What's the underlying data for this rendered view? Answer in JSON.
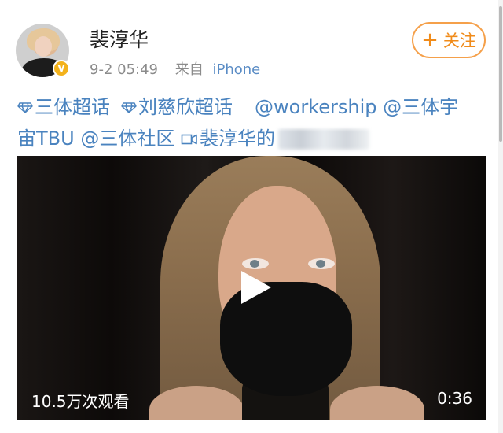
{
  "post": {
    "author": "裴淳华",
    "time": "9-2 05:49",
    "source_prefix": "来自",
    "source_client": "iPhone",
    "follow_label": "关注",
    "follow_icon": "plus-icon",
    "verified_badge": "V",
    "content": {
      "topic_1": "三体超话",
      "topic_2": "刘慈欣超话",
      "mention_1": "@workership",
      "mention_2_line1": "@三体宇",
      "mention_2_line2": "宙TBU",
      "mention_3": "@三体社区",
      "video_link": "裴淳华的"
    },
    "video": {
      "view_count": "10.5万次观看",
      "duration": "0:36"
    }
  },
  "colors": {
    "link": "#4a83bf",
    "follow_accent": "#f08b1a",
    "verified": "#f3b21b",
    "meta": "#8b8b8b"
  }
}
